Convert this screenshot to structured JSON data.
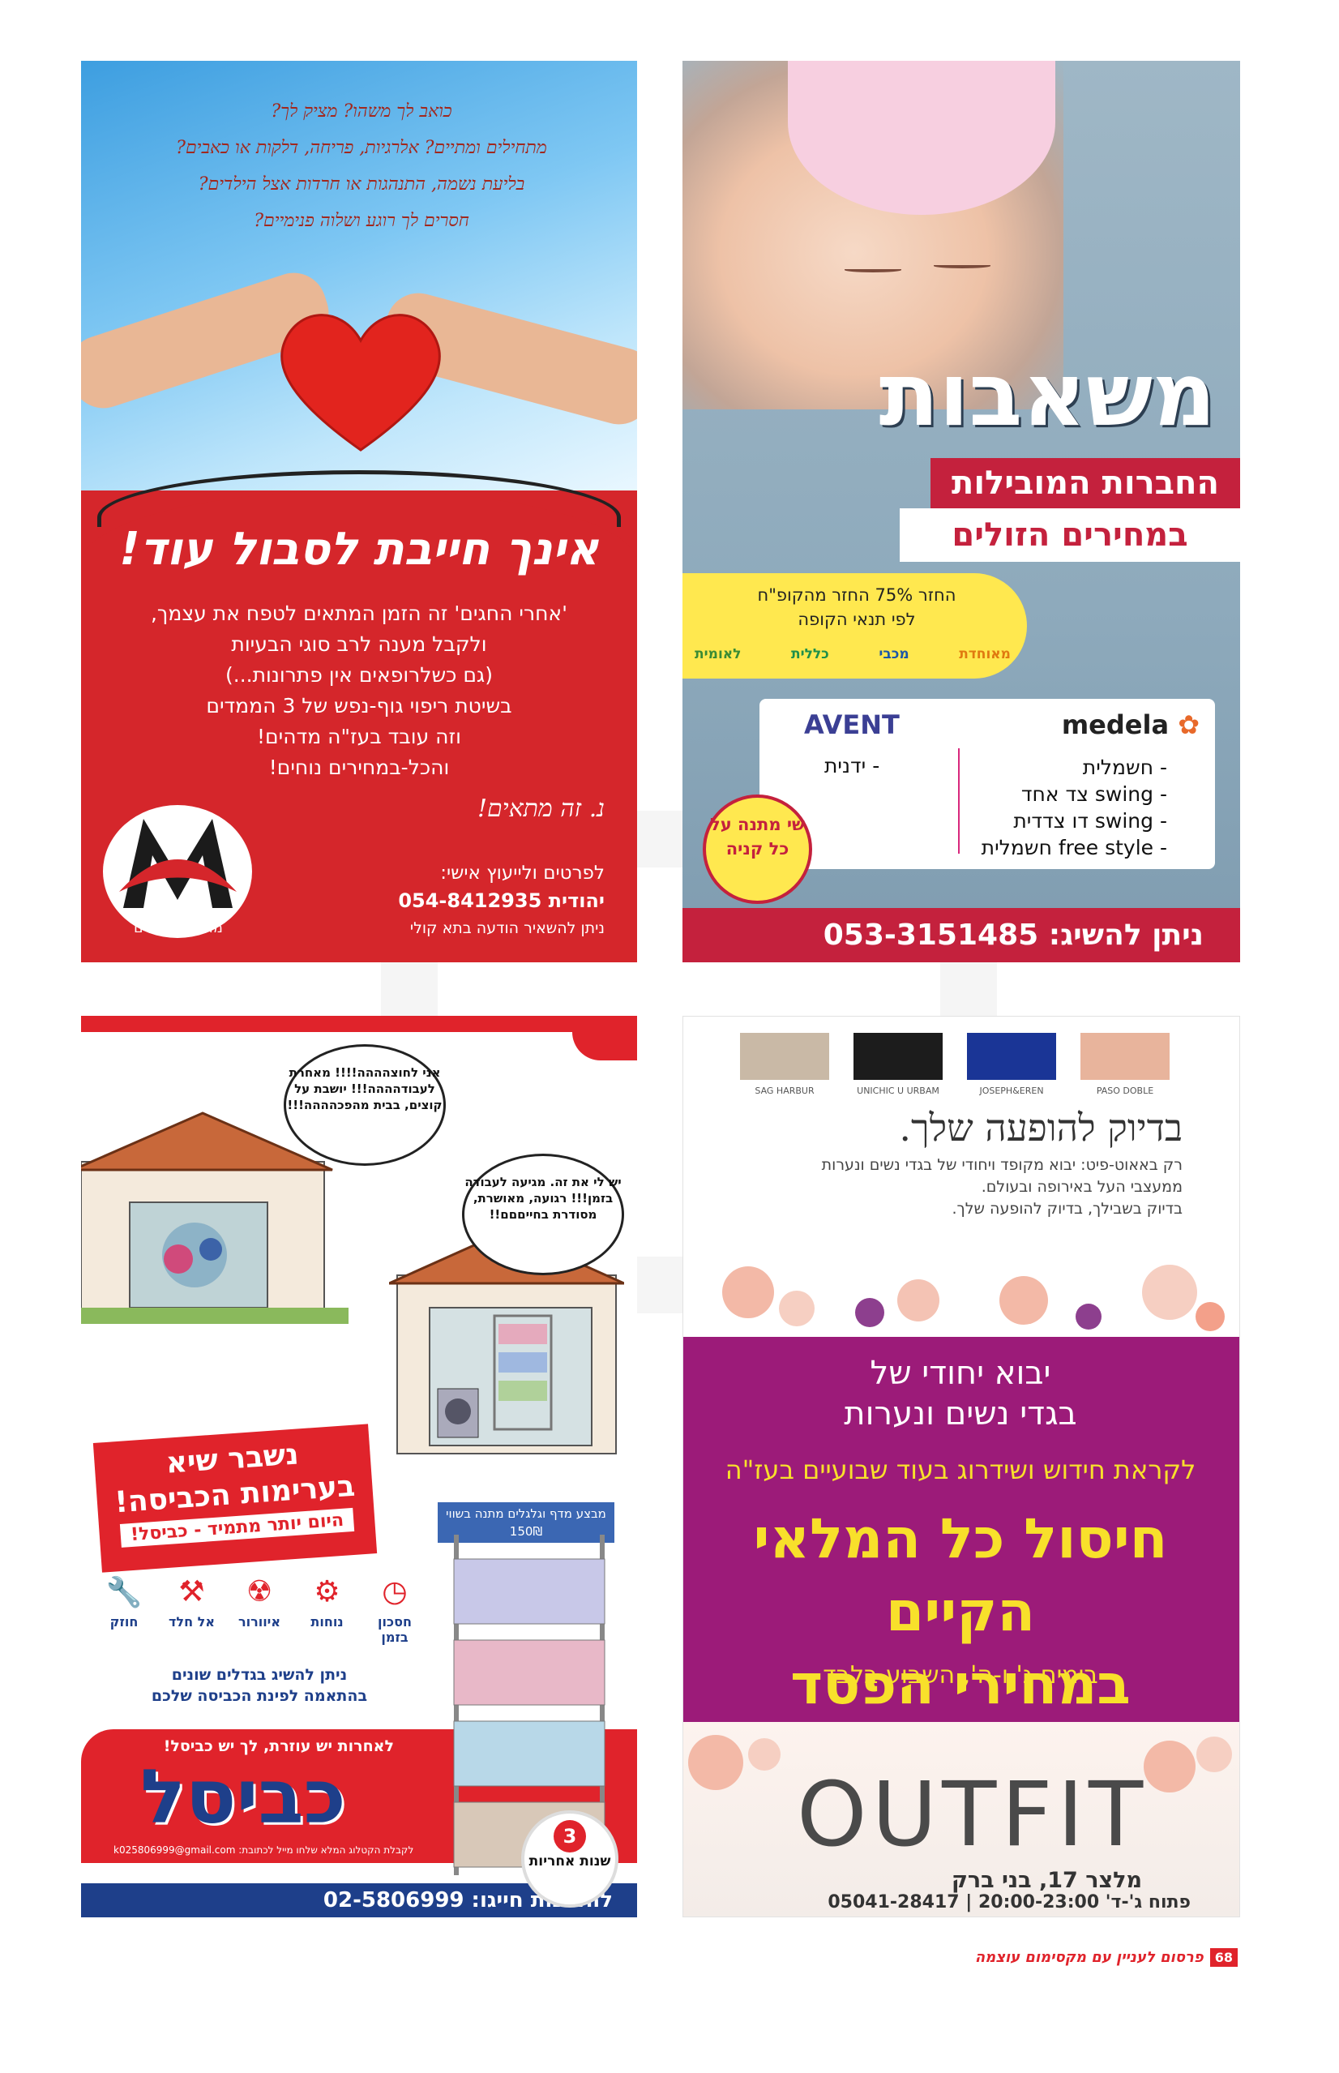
{
  "ad_heart": {
    "script_lines": [
      "כואב לך משהו? מציק לך?",
      "מתחילים ומתיים? אלרגיות, פריחה, דלקות או כאבים?",
      "בליעת נשמה, התנהגות או חרדות אצל הילדים?",
      "חסרים לך רוגע ושלוה פנימיים?"
    ],
    "headline": "אינך חייבת לסבול עוד!",
    "body_lines": [
      "'אחרי החגים' זה הזמן המתאים לטפח את עצמך,",
      "ולקבל מענה לרב סוגי הבעיות",
      "(גם כשלרופאים אין פתרונות...)",
      "בשיטת ריפוי גוף-נפש של 3 הממדים",
      "וזה עובד בעז\"ה מדהים!",
      "והכל-במחירים נוחים!"
    ],
    "signature": "נ. זה מתאים!",
    "contact_label": "לפרטים ולייעוץ אישי:",
    "contact_name": "יהודית",
    "contact_phone": "054-8412935",
    "contact_note": "ניתן להשאיר הודעה בתא קולי",
    "logo_text": "מדהים בממדים"
  },
  "ad_baby": {
    "title": "משאבות",
    "band1": "החברות המובילות",
    "band2": "במחירים הזולים",
    "refund_line1": "החזר 75% החזר מהקופ\"ח",
    "refund_line2": "לפי תנאי הקופה",
    "hmos": [
      "מאוחדת",
      "מכבי",
      "כללית",
      "לאומית"
    ],
    "brand_right": "medela",
    "brand_left": "AVENT",
    "medela_items": [
      "- חשמלית",
      "- swing צד אחד",
      "- swing דו צדדית",
      "- free style חשמלית"
    ],
    "avent_items": [
      "- ידנית"
    ],
    "gift": "שי מתנה על כל קניה",
    "bottom": "ניתן להשיג: 053-3151485"
  },
  "ad_kviscel": {
    "bubble1": "אני לחוצהההה!!!! מאחרת לעבודהההה!!! יושבת על קוצים, בבית מהפכהההה!!!",
    "bubble2": "יש לי את זה. מגיעה לעבודה בזמן!!! רגועה, מאושרת, מסודרת בחייםםם!!",
    "red_line1": "נשבר שיא",
    "red_line2": "בערימות הכביסה!",
    "red_line3": "היום יותר מתמיד - כביסל!",
    "promo": "מבצע מדף וגלגלים מתנה בשווי 150₪",
    "icons": [
      {
        "label": "חסכון בזמן",
        "icon": "clock-icon",
        "glyph": "◷"
      },
      {
        "label": "נוחות",
        "icon": "gears-icon",
        "glyph": "⚙"
      },
      {
        "label": "איוורור",
        "icon": "fan-icon",
        "glyph": "☢"
      },
      {
        "label": "אל חלד",
        "icon": "bolt-icon",
        "glyph": "⚒"
      },
      {
        "label": "חוזק",
        "icon": "wrench-icon",
        "glyph": "🔧"
      }
    ],
    "sizes_line1": "ניתן להשיג בגדלים שונים",
    "sizes_line2": "בהתאמה לפינת הכביסה שלכם",
    "tagline": "לאחרות יש עוזרת, לך יש כביסל!",
    "brand": "כביסל",
    "email": "לקבלת הקטלוג המלא שלחו מייל לכתובת: k025806999@gmail.com",
    "warranty_num": "3",
    "warranty_text": "שנות אחריות",
    "bottom": "להזמנות חייגו: 02-5806999"
  },
  "ad_outfit": {
    "swatches": [
      {
        "label": "SAG HARBUR",
        "color": "#c9b9a6"
      },
      {
        "label": "UNICHIC U URBAM",
        "color": "#1c1c1c"
      },
      {
        "label": "JOSEPH&EREN",
        "color": "#1a3596"
      },
      {
        "label": "PASO DOBLE",
        "color": "#e8b49c"
      }
    ],
    "headline": "בדיוק להופעה שלך.",
    "sub1": "רק באאוט-פיט: יבוא מקופד ויחודי של בגדי נשים ונערות",
    "sub2": "ממעצבי העל באירופה ובעולם.",
    "sub3": "בדיוק בשבילך, בדיוק להופעה שלך.",
    "m1_line1": "יבוא יחודי של",
    "m1_line2": "בגדי נשים ונערות",
    "m2": "לקראת חידוש ושידרוג בעוד שבועיים בעז\"ה",
    "m3_line1": "חיסול כל המלאי הקיים",
    "m3_line2": "במחירי הפסד",
    "m4": "בימים ג' ו-ה', השבוע בלבד",
    "logo": "OUTFIT",
    "address": "מלצר 17, בני ברק",
    "hours": "פתוח ג'-ד' 20:00-23:00 | 05041-28417"
  },
  "footer": {
    "page_number": "68",
    "text": "פרסום לעניין עם מקסימום עוצמה"
  }
}
